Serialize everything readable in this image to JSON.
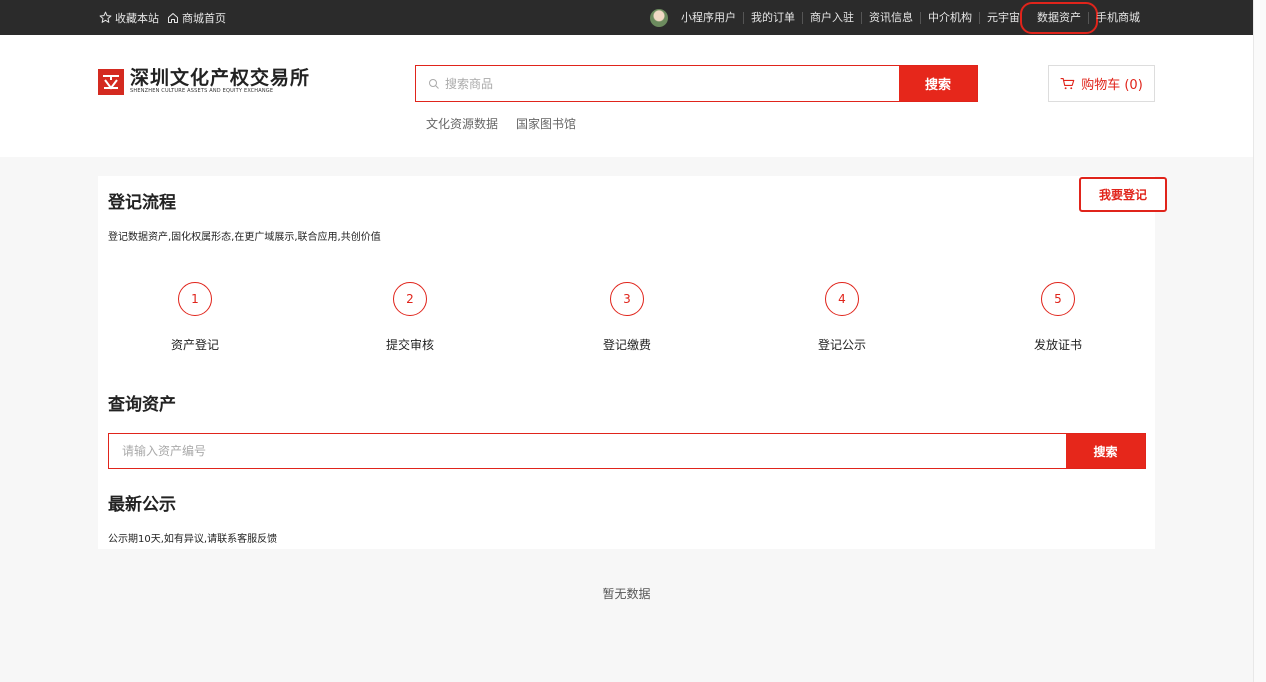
{
  "topbar": {
    "favorite": "收藏本站",
    "home": "商城首页",
    "user": "小程序用户",
    "links": [
      "我的订单",
      "商户入驻",
      "资讯信息",
      "中介机构",
      "元宇宙",
      "数据资产",
      "手机商城"
    ],
    "highlighted": "数据资产"
  },
  "header": {
    "logo_main": "深圳文化产权交易所",
    "logo_sub": "SHENZHEN CULTURE ASSETS AND EQUITY EXCHANGE",
    "search_placeholder": "搜索商品",
    "search_button": "搜索",
    "hot_links": [
      "文化资源数据",
      "国家图书馆"
    ],
    "cart_label": "购物车 (0)"
  },
  "process": {
    "title": "登记流程",
    "desc": "登记数据资产,固化权属形态,在更广域展示,联合应用,共创价值",
    "register_button": "我要登记",
    "steps": [
      {
        "num": "1",
        "label": "资产登记"
      },
      {
        "num": "2",
        "label": "提交审核"
      },
      {
        "num": "3",
        "label": "登记缴费"
      },
      {
        "num": "4",
        "label": "登记公示"
      },
      {
        "num": "5",
        "label": "发放证书"
      }
    ]
  },
  "query": {
    "title": "查询资产",
    "placeholder": "请输入资产编号",
    "button": "搜索"
  },
  "notice": {
    "title": "最新公示",
    "desc": "公示期10天,如有异议,请联系客服反馈",
    "empty": "暂无数据"
  },
  "colors": {
    "accent": "#e6271b",
    "topbar": "#2b2b2b"
  }
}
